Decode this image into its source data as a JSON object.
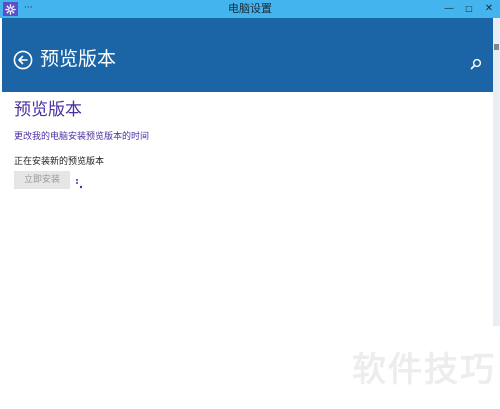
{
  "window": {
    "title": "电脑设置",
    "menu_glyph": "···",
    "minimize_glyph": "—",
    "maximize_glyph": "□",
    "close_glyph": "✕",
    "app_icon": "gear-icon"
  },
  "header": {
    "title": "预览版本",
    "back_icon": "back-arrow-icon",
    "search_icon": "search-icon"
  },
  "content": {
    "heading": "预览版本",
    "change_link": "更改我的电脑安装预览版本的时间",
    "status": "正在安装新的预览版本",
    "install_button": "立即安装",
    "install_button_disabled": true
  },
  "watermark": "软件技巧",
  "colors": {
    "titlebar": "#44b4ee",
    "header": "#1b64a6",
    "accent_text": "#4b2fa3"
  }
}
